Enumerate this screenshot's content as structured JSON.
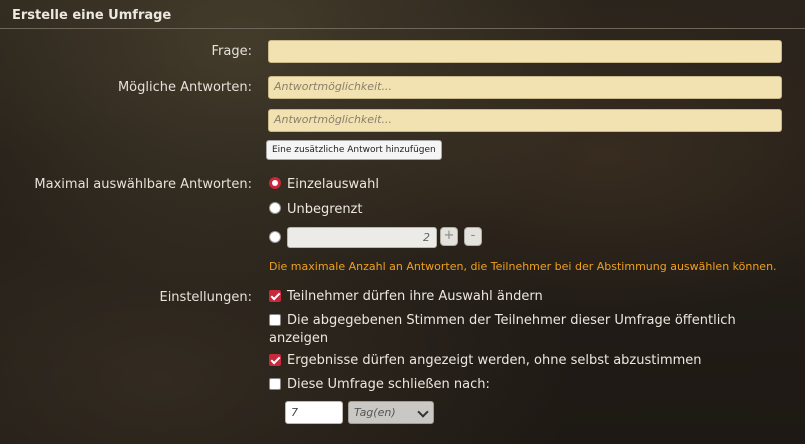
{
  "header": {
    "title": "Erstelle eine Umfrage"
  },
  "question": {
    "label": "Frage:",
    "value": ""
  },
  "answers": {
    "label": "Mögliche Antworten:",
    "fields": [
      {
        "placeholder": "Antwortmöglichkeit..."
      },
      {
        "placeholder": "Antwortmöglichkeit..."
      }
    ],
    "add_button": "Eine zusätzliche Antwort hinzufügen"
  },
  "max_answers": {
    "label": "Maximal auswählbare Antworten:",
    "options": [
      {
        "label": "Einzelauswahl",
        "selected": true
      },
      {
        "label": "Unbegrenzt",
        "selected": false
      },
      {
        "label": "",
        "selected": false
      }
    ],
    "custom_value": "2",
    "plus": "+",
    "minus": "-",
    "hint": "Die maximale Anzahl an Antworten, die Teilnehmer bei der Abstimmung auswählen können."
  },
  "settings": {
    "label": "Einstellungen:",
    "options": [
      {
        "label": "Teilnehmer dürfen ihre Auswahl ändern",
        "checked": true
      },
      {
        "label_line1": "Die abgegebenen Stimmen der Teilnehmer dieser Umfrage öffentlich",
        "label_line2": "anzeigen",
        "checked": false
      },
      {
        "label": "Ergebnisse dürfen angezeigt werden, ohne selbst abzustimmen",
        "checked": true
      },
      {
        "label": "Diese Umfrage schließen nach:",
        "checked": false
      }
    ],
    "close_after_value": "7",
    "close_after_unit": "Tag(en)"
  },
  "colors": {
    "accent": "#c8283a",
    "hint": "#f0a020",
    "input_bg": "#f2e1b1"
  }
}
